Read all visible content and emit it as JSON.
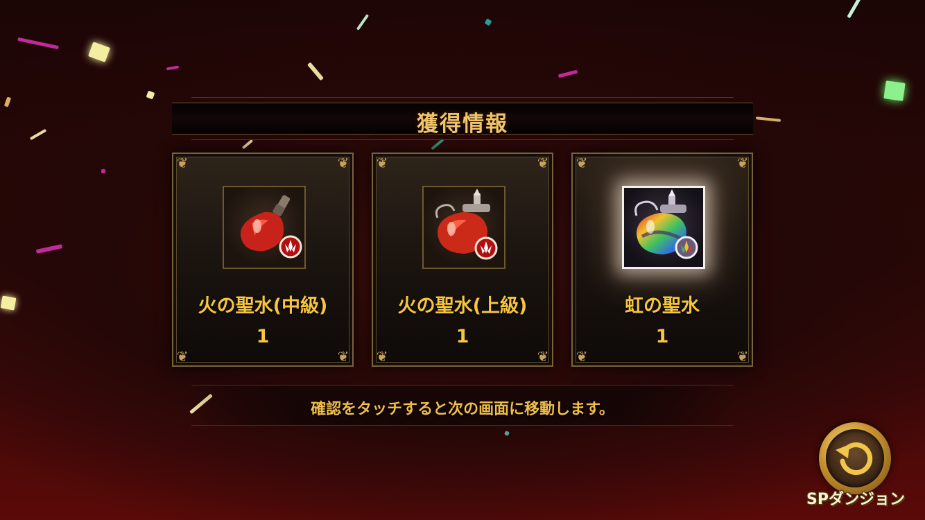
{
  "header": {
    "title": "獲得情報"
  },
  "rewards": [
    {
      "name": "火の聖水(中級)",
      "quantity": "1",
      "icon": "fire-holy-water-medium-icon",
      "element": "fire-element-badge-icon"
    },
    {
      "name": "火の聖水(上級)",
      "quantity": "1",
      "icon": "fire-holy-water-high-icon",
      "element": "fire-element-badge-icon"
    },
    {
      "name": "虹の聖水",
      "quantity": "1",
      "icon": "rainbow-holy-water-icon",
      "element": "rainbow-element-badge-icon"
    }
  ],
  "footer": {
    "message": "確認をタッチすると次の画面に移動します。"
  },
  "sp_dungeon_button": {
    "label": "SPダンジョン"
  },
  "colors": {
    "accent_gold": "#f7c63c",
    "frame_gold": "#7b6339",
    "background_red": "#5a0a08"
  }
}
